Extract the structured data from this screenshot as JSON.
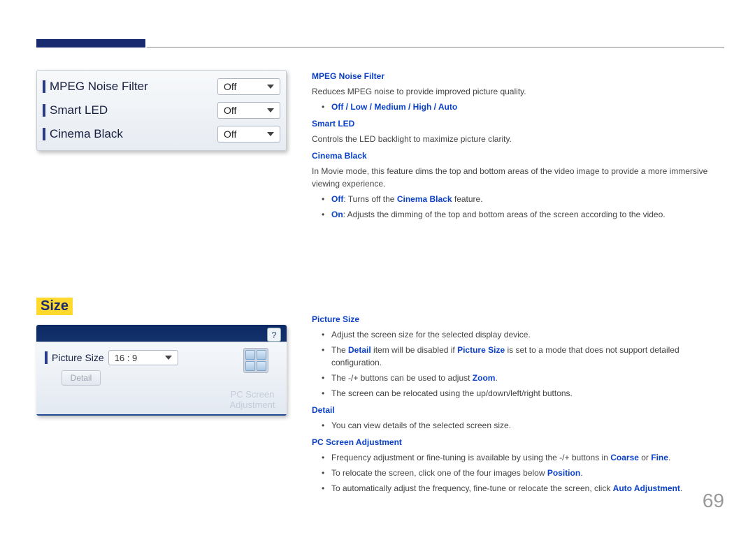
{
  "page_number": "69",
  "top_section": {
    "menu": {
      "rows": [
        {
          "label": "MPEG Noise Filter",
          "value": "Off"
        },
        {
          "label": "Smart LED",
          "value": "Off"
        },
        {
          "label": "Cinema Black",
          "value": "Off"
        }
      ]
    },
    "right": {
      "mpeg_title": "MPEG Noise Filter",
      "mpeg_desc": "Reduces MPEG noise to provide improved picture quality.",
      "mpeg_options": "Off / Low / Medium / High / Auto",
      "smart_title": "Smart LED",
      "smart_desc": "Controls the LED backlight to maximize picture clarity.",
      "cinema_title": "Cinema Black",
      "cinema_desc": "In Movie mode, this feature dims the top and bottom areas of the video image to provide a more immersive viewing experience.",
      "cinema_off_kw": "Off",
      "cinema_off_txt": ": Turns off the ",
      "cinema_off_kw2": "Cinema Black",
      "cinema_off_txt2": " feature.",
      "cinema_on_kw": "On",
      "cinema_on_txt": ": Adjusts the dimming of the top and bottom areas of the screen according to the video."
    }
  },
  "size_section": {
    "heading": "Size",
    "menu": {
      "picture_size_label": "Picture Size",
      "picture_size_value": "16 : 9",
      "detail_label": "Detail",
      "pcsa_label_l1": "PC Screen",
      "pcsa_label_l2": "Adjustment",
      "help": "?"
    },
    "right": {
      "ps_title": "Picture Size",
      "ps_b1": "Adjust the screen size for the selected display device.",
      "ps_b2_a": "The ",
      "ps_b2_kw1": "Detail",
      "ps_b2_b": " item will be disabled if ",
      "ps_b2_kw2": "Picture Size",
      "ps_b2_c": " is set to a mode that does not support detailed configuration.",
      "ps_b3_a": "The -/+ buttons can be used to adjust ",
      "ps_b3_kw": "Zoom",
      "ps_b3_b": ".",
      "ps_b4": "The screen can be relocated using the up/down/left/right buttons.",
      "detail_title": "Detail",
      "detail_b1": "You can view details of the selected screen size.",
      "pcsa_title": "PC Screen Adjustment",
      "pcsa_b1_a": "Frequency adjustment or fine-tuning is available by using the -/+ buttons in ",
      "pcsa_b1_kw1": "Coarse",
      "pcsa_b1_mid": " or ",
      "pcsa_b1_kw2": "Fine",
      "pcsa_b1_b": ".",
      "pcsa_b2_a": "To relocate the screen, click one of the four images below ",
      "pcsa_b2_kw": "Position",
      "pcsa_b2_b": ".",
      "pcsa_b3_a": "To automatically adjust the frequency, fine-tune or relocate the screen, click ",
      "pcsa_b3_kw": "Auto Adjustment",
      "pcsa_b3_b": "."
    }
  }
}
